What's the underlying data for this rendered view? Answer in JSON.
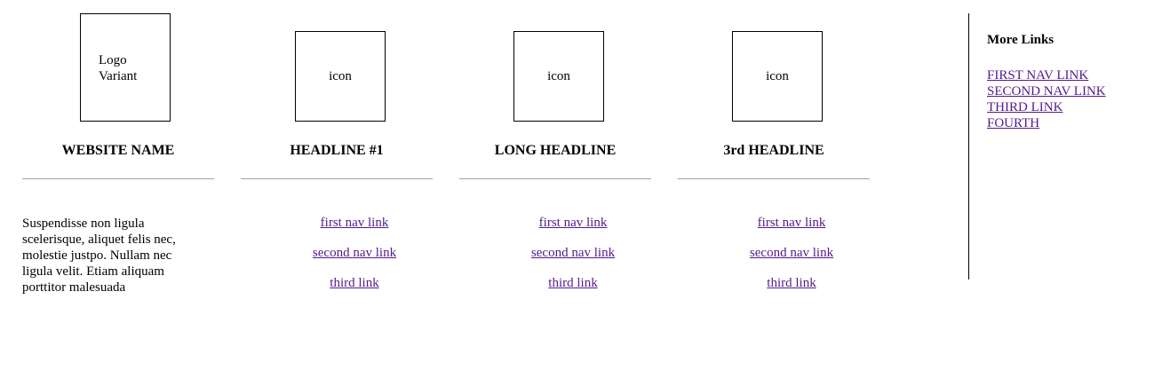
{
  "brand": {
    "logo_text": "Logo Variant",
    "website_name": "WEBSITE NAME",
    "description": "Suspendisse non ligula scelerisque, aliquet felis nec, molestie justpo. Nullam nec ligula velit. Etiam aliquam porttitor malesuada"
  },
  "columns": [
    {
      "icon_label": "icon",
      "headline": "HEADLINE #1",
      "links": [
        "first nav link",
        "second nav link",
        "third link"
      ]
    },
    {
      "icon_label": "icon",
      "headline": "LONG HEADLINE",
      "links": [
        "first nav link",
        "second nav link",
        "third link"
      ]
    },
    {
      "icon_label": "icon",
      "headline": "3rd HEADLINE",
      "links": [
        "first nav link",
        "second nav link",
        "third link"
      ]
    }
  ],
  "aside": {
    "title": "More Links",
    "links": [
      "FIRST NAV LINK",
      "SECOND NAV LINK",
      "THIRD LINK",
      "FOURTH"
    ]
  },
  "colors": {
    "link_visited": "#551a8b",
    "rule": "#a0a0a0"
  }
}
